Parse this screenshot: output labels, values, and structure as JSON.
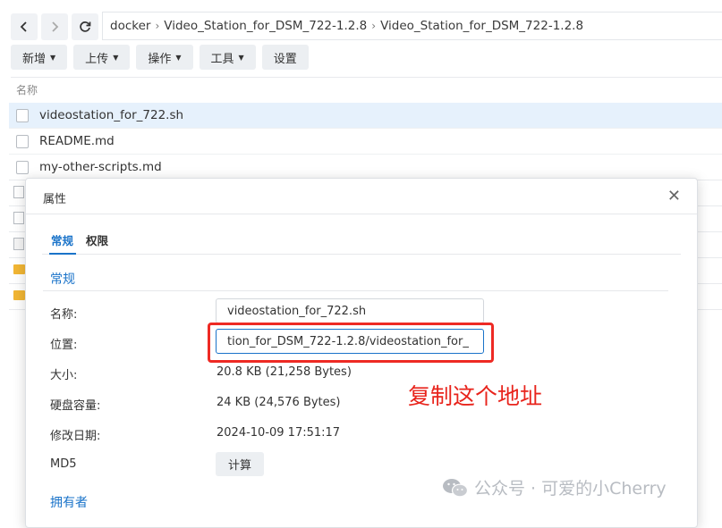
{
  "nav": {
    "back_icon": "chevron-left-icon",
    "forward_icon": "chevron-right-icon",
    "refresh_icon": "refresh-icon"
  },
  "breadcrumb": [
    "docker",
    "Video_Station_for_DSM_722-1.2.8",
    "Video_Station_for_DSM_722-1.2.8"
  ],
  "toolbar": {
    "new": "新增",
    "upload": "上传",
    "action": "操作",
    "tools": "工具",
    "settings": "设置"
  },
  "list": {
    "column_name": "名称",
    "files": [
      {
        "name": "videostation_for_722.sh",
        "selected": true
      },
      {
        "name": "README.md",
        "selected": false
      },
      {
        "name": "my-other-scripts.md",
        "selected": false
      }
    ]
  },
  "dialog": {
    "title": "属性",
    "tabs": [
      "常规",
      "权限"
    ],
    "section_general": "常规",
    "name_label": "名称:",
    "name_value": "videostation_for_722.sh",
    "location_label": "位置:",
    "location_value": "tion_for_DSM_722-1.2.8/videostation_for_",
    "size_label": "大小:",
    "size_value": "20.8 KB (21,258 Bytes)",
    "disk_label": "硬盘容量:",
    "disk_value": "24 KB (24,576 Bytes)",
    "modified_label": "修改日期:",
    "modified_value": "2024-10-09 17:51:17",
    "md5_label": "MD5",
    "md5_button": "计算",
    "section_owner": "拥有者"
  },
  "annotation": "复制这个地址",
  "watermark": "公众号 · 可爱的小Cherry"
}
